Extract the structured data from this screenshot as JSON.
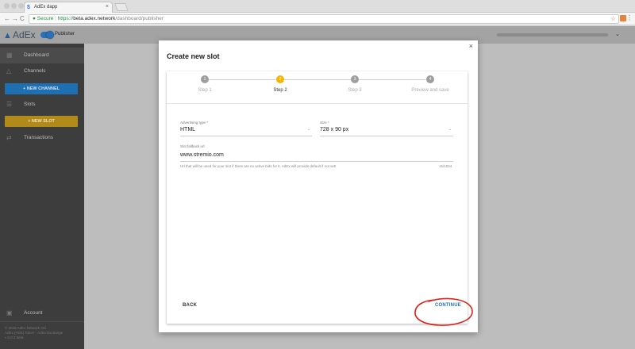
{
  "browser": {
    "tab_title": "AdEx dapp",
    "tab_close": "×",
    "secure_label": "Secure",
    "url_scheme": "https://",
    "url_host": "beta.adex.network",
    "url_path": "/dashboard/publisher",
    "back": "←",
    "forward": "→",
    "reload": "C",
    "star": "☆",
    "menu": "⋮"
  },
  "app": {
    "logo_text": "AdEx",
    "mode_label": "Publisher",
    "user_chevron": "⌄"
  },
  "sidebar": {
    "items": [
      {
        "label": "Dashboard"
      },
      {
        "label": "Channels"
      },
      {
        "label": "Slots"
      },
      {
        "label": "Transactions"
      }
    ],
    "new_channel": "+ NEW CHANNEL",
    "new_slot": "+ NEW SLOT",
    "account": "Account",
    "footer": [
      "© 2018 AdEx Network OÜ",
      "AdEx (ADX) Token - AdEx Exchange",
      "v 0.0.2 beta"
    ]
  },
  "modal": {
    "title": "Create new slot",
    "close": "×",
    "steps": [
      {
        "num": "1",
        "label": "Step 1"
      },
      {
        "num": "2",
        "label": "Step 2"
      },
      {
        "num": "3",
        "label": "Step 3"
      },
      {
        "num": "4",
        "label": "Preview and save"
      }
    ],
    "active_step": 2,
    "fields": {
      "ad_type_label": "Advertising type *",
      "ad_type_value": "HTML",
      "size_label": "Size *",
      "size_value": "728 x 90 px",
      "fallback_label": "Slot fallback url",
      "fallback_value": "www.stremio.com",
      "fallback_help": "Url that will be used for your slot if there are no active bids for it. AdEx will provide default if not set!",
      "fallback_count": "15/1024",
      "chevron": "⌄"
    },
    "back_label": "BACK",
    "continue_label": "CONTINUE"
  },
  "colors": {
    "accent_blue": "#1f6fb3",
    "accent_yellow": "#f7b500",
    "annotation_red": "#e0231a"
  }
}
